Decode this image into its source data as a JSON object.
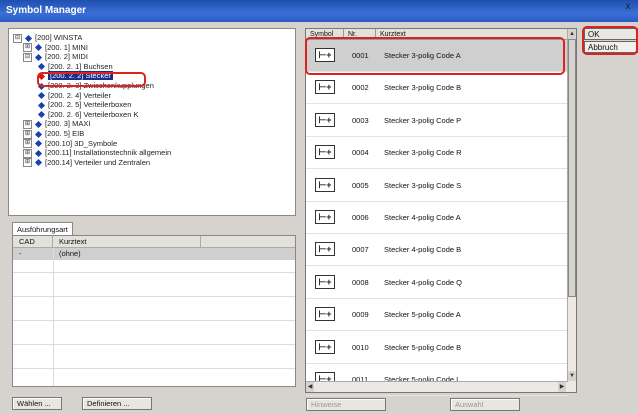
{
  "window": {
    "title": "Symbol Manager",
    "close_label": "x"
  },
  "tree": {
    "items": [
      {
        "expander": "⊟",
        "label": "[200] WINSTA",
        "selected": false
      },
      {
        "expander": "⊞",
        "label": "[200. 1] MINI",
        "selected": false
      },
      {
        "expander": "⊟",
        "label": "[200. 2] MIDI",
        "selected": false
      },
      {
        "expander": "",
        "label": "[200. 2. 1] Buchsen",
        "selected": false
      },
      {
        "expander": "",
        "label": "[200. 2. 2] Stecker",
        "selected": true
      },
      {
        "expander": "",
        "label": "[200. 2. 3] Zwischenkupplungen",
        "selected": false
      },
      {
        "expander": "",
        "label": "[200. 2. 4] Verteiler",
        "selected": false
      },
      {
        "expander": "",
        "label": "[200. 2. 5] Verteilerboxen",
        "selected": false
      },
      {
        "expander": "",
        "label": "[200. 2. 6] Verteilerboxen K",
        "selected": false
      },
      {
        "expander": "⊞",
        "label": "[200. 3] MAXI",
        "selected": false
      },
      {
        "expander": "⊞",
        "label": "[200. 5] EIB",
        "selected": false
      },
      {
        "expander": "⊞",
        "label": "[200.10] 3D_Symbole",
        "selected": false
      },
      {
        "expander": "⊞",
        "label": "[200.11] Installationstechnik allgemein",
        "selected": false
      },
      {
        "expander": "⊞",
        "label": "[200.14] Verteiler und Zentralen",
        "selected": false
      }
    ]
  },
  "variants": {
    "tab_label": "Ausführungsart",
    "columns": [
      "CAD",
      "Kurztext"
    ],
    "rows": [
      {
        "cad": "-",
        "kurztext": "(ohne)"
      }
    ],
    "choose_button": "Wählen ...",
    "define_button": "Definieren ..."
  },
  "symbols": {
    "columns": [
      "Symbol",
      "Nr.",
      "Kurztext"
    ],
    "rows": [
      {
        "nr": "0001",
        "kurztext": "Stecker 3-polig Code A",
        "selected": true
      },
      {
        "nr": "0002",
        "kurztext": "Stecker 3-polig Code B",
        "selected": false
      },
      {
        "nr": "0003",
        "kurztext": "Stecker 3-polig Code P",
        "selected": false
      },
      {
        "nr": "0004",
        "kurztext": "Stecker 3-polig Code R",
        "selected": false
      },
      {
        "nr": "0005",
        "kurztext": "Stecker 3-polig Code S",
        "selected": false
      },
      {
        "nr": "0006",
        "kurztext": "Stecker 4-polig Code A",
        "selected": false
      },
      {
        "nr": "0007",
        "kurztext": "Stecker 4-polig Code B",
        "selected": false
      },
      {
        "nr": "0008",
        "kurztext": "Stecker 4-polig Code Q",
        "selected": false
      },
      {
        "nr": "0009",
        "kurztext": "Stecker 5-polig Code A",
        "selected": false
      },
      {
        "nr": "0010",
        "kurztext": "Stecker 5-polig Code B",
        "selected": false
      },
      {
        "nr": "0011",
        "kurztext": "Stecker 5-polig Code I",
        "selected": false
      }
    ],
    "symbol_glyph": "⊢+",
    "bottom_left_label": "Hinweise",
    "bottom_right_button": "Auswahl"
  },
  "buttons": {
    "ok": "OK",
    "cancel": "Abbruch"
  },
  "colors": {
    "highlight": "#d22222",
    "tree_selection": "#1a2f86",
    "diamond": "#1a3fae"
  }
}
